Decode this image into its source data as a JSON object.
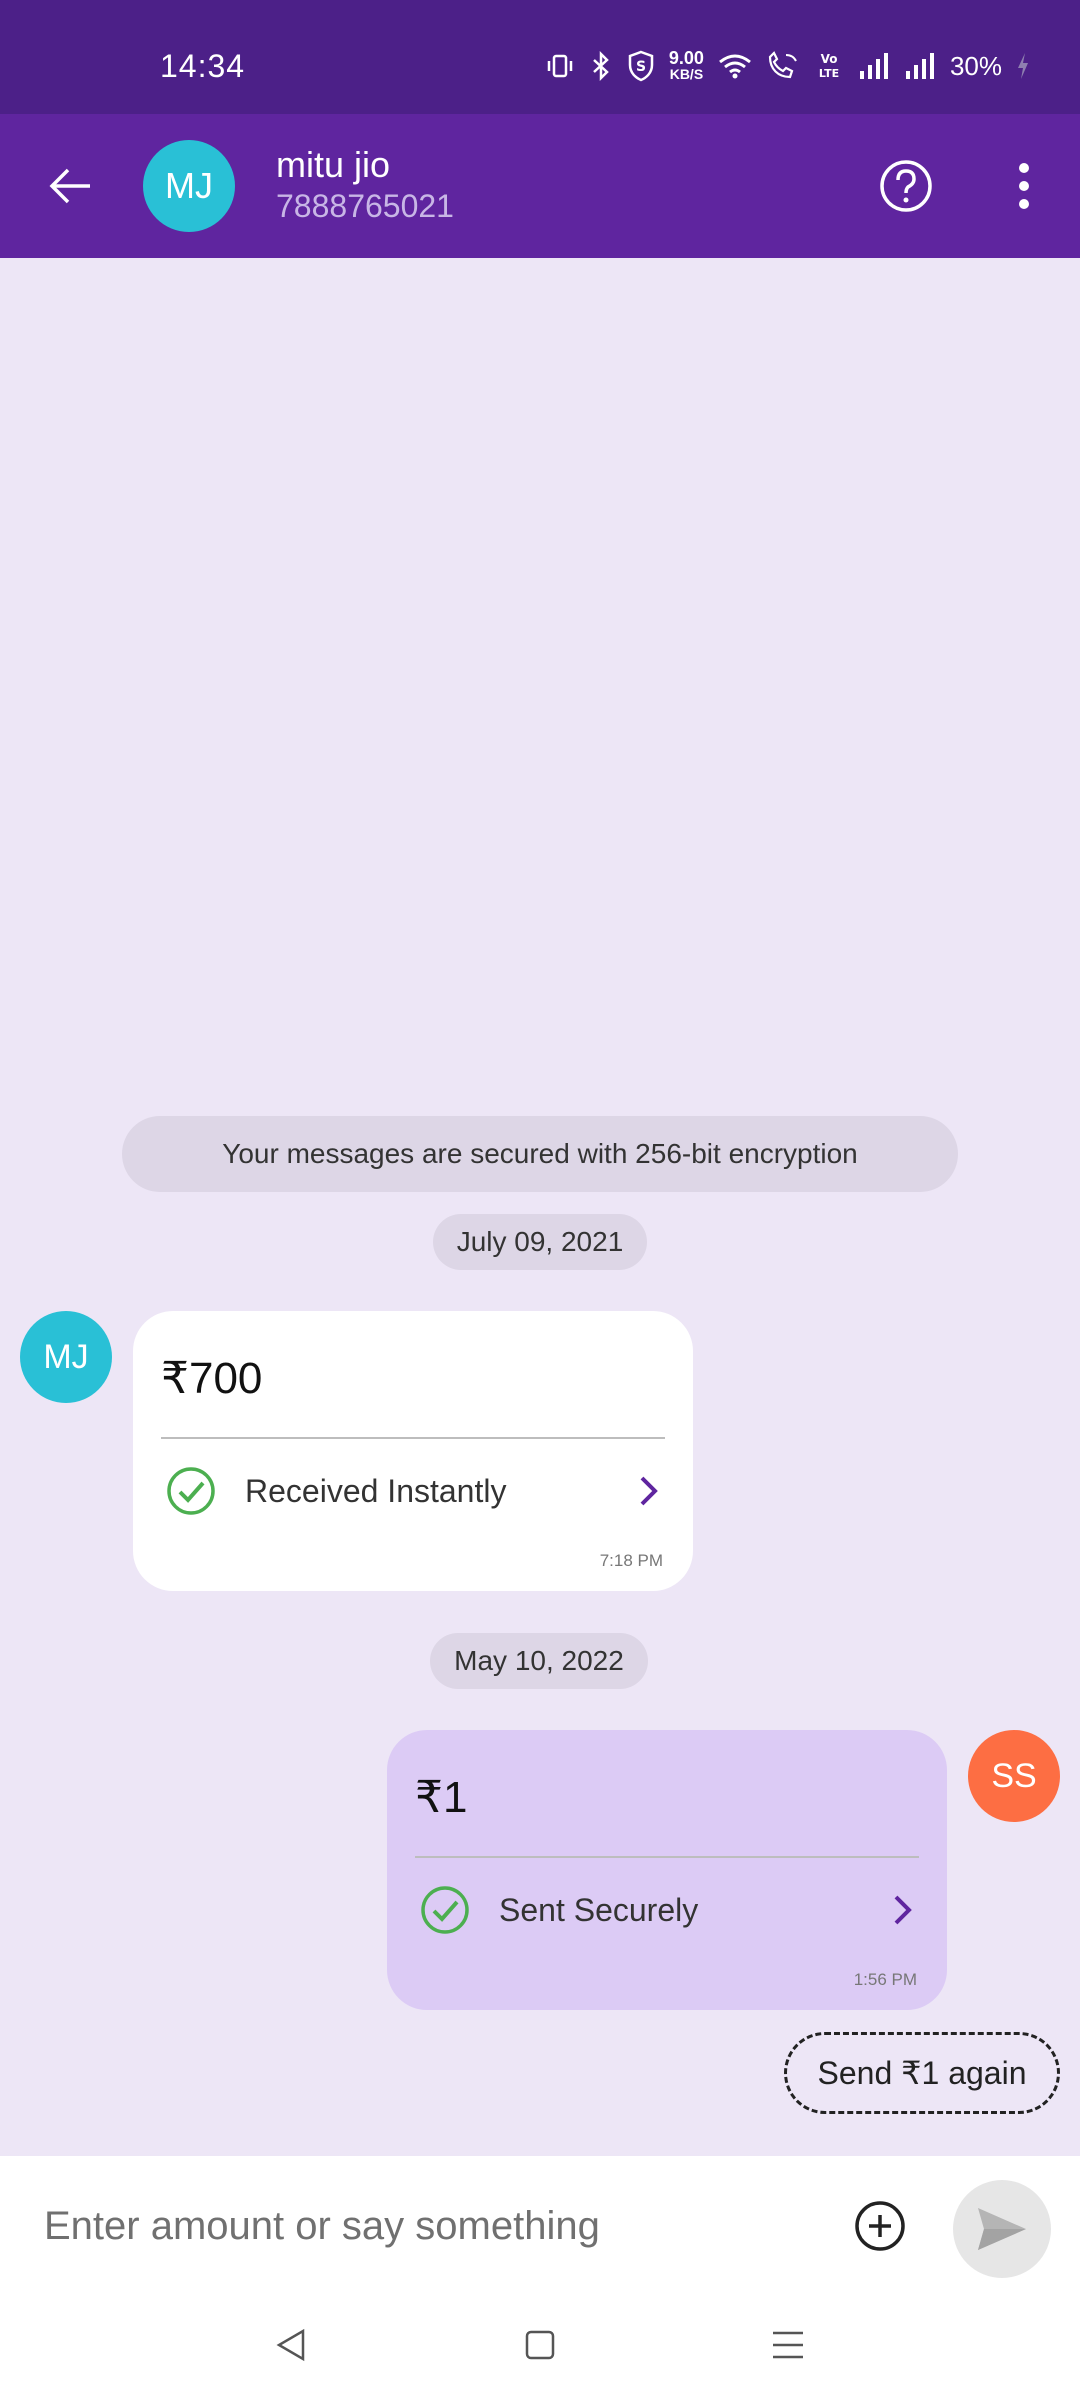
{
  "status_bar": {
    "time": "14:34",
    "net_speed_value": "9.00",
    "net_speed_unit": "KB/S",
    "battery": "30%",
    "icons": [
      "vibrate-icon",
      "bluetooth-icon",
      "shield-icon",
      "wifi-icon",
      "wifi-calling-icon",
      "volte-icon",
      "signal-icon",
      "signal-icon",
      "charging-icon"
    ]
  },
  "header": {
    "avatar_initials": "MJ",
    "contact_name": "mitu jio",
    "contact_phone": "7888765021",
    "icons": [
      "back-arrow-icon",
      "help-icon",
      "more-vertical-icon"
    ]
  },
  "chat": {
    "encryption_notice": "Your messages are secured with 256-bit encryption",
    "messages": [
      {
        "date": "July 09, 2021",
        "avatar_initials": "MJ",
        "amount": "₹700",
        "status": "Received Instantly",
        "time": "7:18 PM",
        "direction": "received"
      },
      {
        "date": "May 10, 2022",
        "avatar_initials": "SS",
        "amount": "₹1",
        "status": "Sent Securely",
        "time": "1:56 PM",
        "direction": "sent"
      }
    ],
    "send_again_label": "Send ₹1 again"
  },
  "input_bar": {
    "placeholder": "Enter amount or say something",
    "value": ""
  },
  "colors": {
    "status_bar_bg": "#4c2088",
    "header_bg": "#5f259f",
    "chat_bg": "#ede6f6",
    "received_bubble": "#ffffff",
    "sent_bubble": "#dccbf5",
    "avatar_mj": "#29c0d6",
    "avatar_ss": "#fd6e43",
    "success_green": "#4caf50",
    "chevron_purple": "#5f259f"
  }
}
